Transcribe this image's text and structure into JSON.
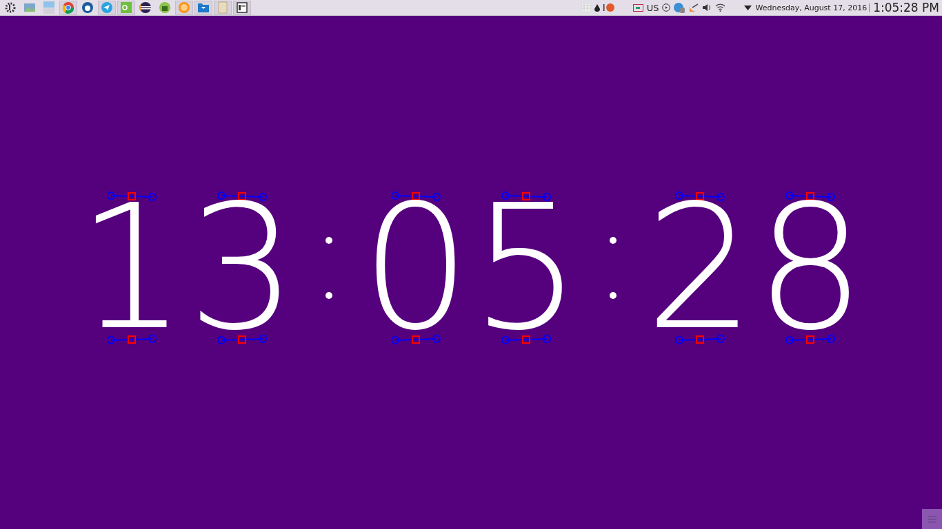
{
  "taskbar": {
    "keyboard_layout": "US",
    "date": "Wednesday, August 17, 2016",
    "time": "1:05:28 PM"
  },
  "clock": {
    "groups": [
      [
        "1",
        "3"
      ],
      [
        "0",
        "5"
      ],
      [
        "2",
        "8"
      ]
    ]
  }
}
